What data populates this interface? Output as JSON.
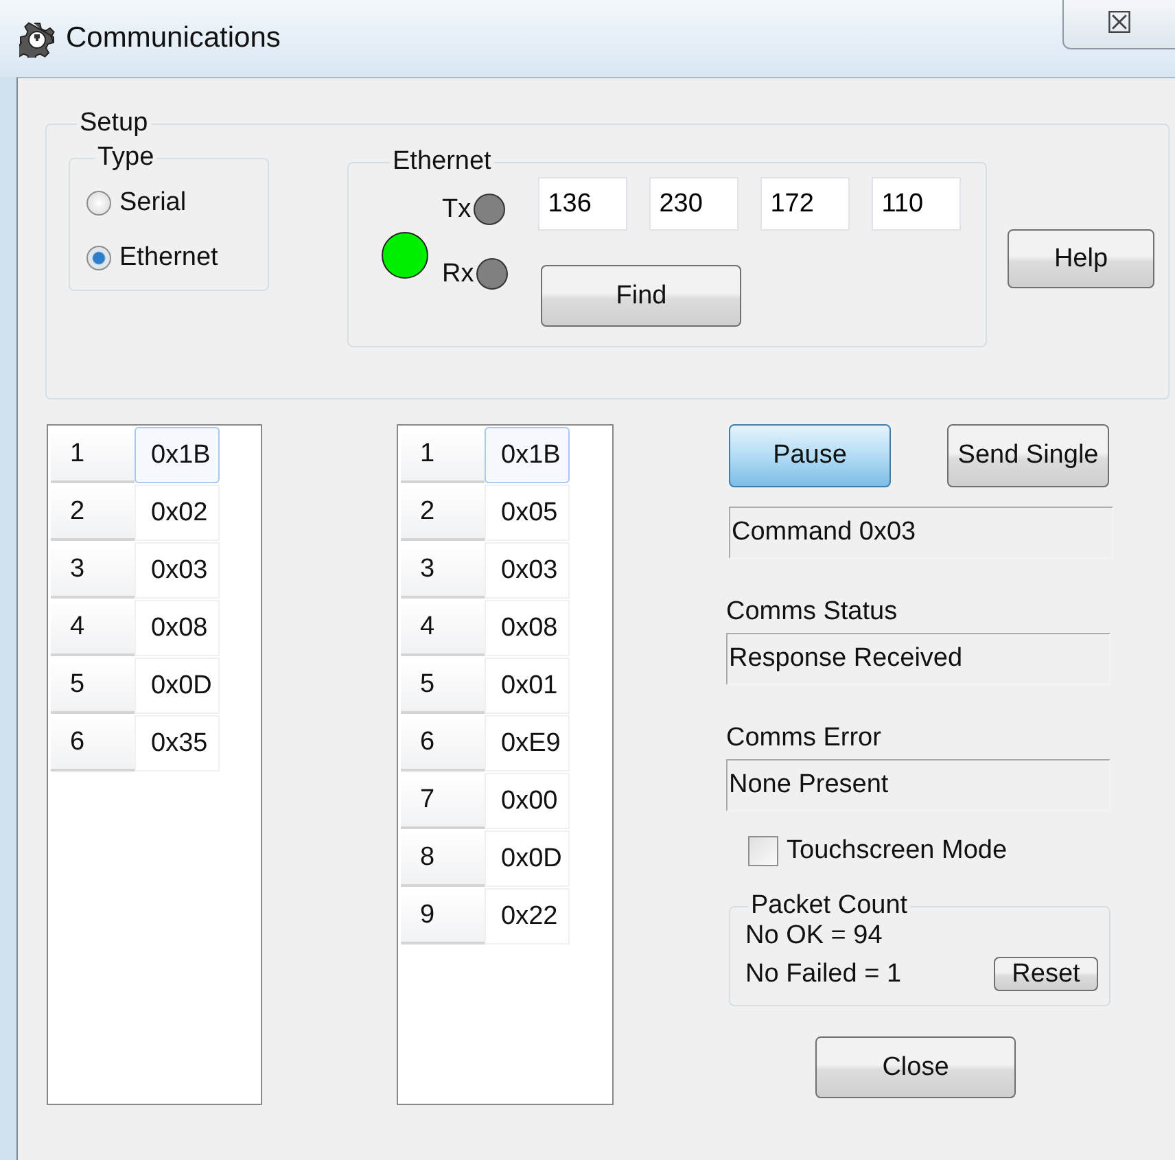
{
  "window": {
    "title": "Communications",
    "close_glyph": "☒"
  },
  "setup": {
    "label": "Setup",
    "type": {
      "label": "Type",
      "options": [
        {
          "label": "Serial",
          "selected": false
        },
        {
          "label": "Ethernet",
          "selected": true
        }
      ]
    },
    "ethernet": {
      "label": "Ethernet",
      "link_on": true,
      "indicators": [
        {
          "label": "Tx",
          "on": false
        },
        {
          "label": "Rx",
          "on": false
        }
      ],
      "ip_octets": [
        "136",
        "230",
        "172",
        "110"
      ],
      "find_button": "Find"
    },
    "help_button": "Help"
  },
  "sent_list": [
    {
      "index": "1",
      "value": "0x1B",
      "selected": true
    },
    {
      "index": "2",
      "value": "0x02",
      "selected": false
    },
    {
      "index": "3",
      "value": "0x03",
      "selected": false
    },
    {
      "index": "4",
      "value": "0x08",
      "selected": false
    },
    {
      "index": "5",
      "value": "0x0D",
      "selected": false
    },
    {
      "index": "6",
      "value": "0x35",
      "selected": false
    }
  ],
  "received_list": [
    {
      "index": "1",
      "value": "0x1B",
      "selected": true
    },
    {
      "index": "2",
      "value": "0x05",
      "selected": false
    },
    {
      "index": "3",
      "value": "0x03",
      "selected": false
    },
    {
      "index": "4",
      "value": "0x08",
      "selected": false
    },
    {
      "index": "5",
      "value": "0x01",
      "selected": false
    },
    {
      "index": "6",
      "value": "0xE9",
      "selected": false
    },
    {
      "index": "7",
      "value": "0x00",
      "selected": false
    },
    {
      "index": "8",
      "value": "0x0D",
      "selected": false
    },
    {
      "index": "9",
      "value": "0x22",
      "selected": false
    }
  ],
  "buttons": [
    {
      "label": "Pause",
      "selected": true
    },
    {
      "label": "Send Single",
      "selected": false
    }
  ],
  "command": "Command 0x03",
  "comms_status": {
    "label": "Comms Status",
    "value": "Response Received"
  },
  "comms_error": {
    "label": "Comms Error",
    "value": "None Present"
  },
  "touchscreen_mode": {
    "label": "Touchscreen Mode",
    "checked": false
  },
  "packet_count": {
    "label": "Packet Count",
    "ok": "No OK = 94",
    "failed": "No Failed = 1",
    "reset_button": "Reset"
  },
  "close_button": "Close"
}
